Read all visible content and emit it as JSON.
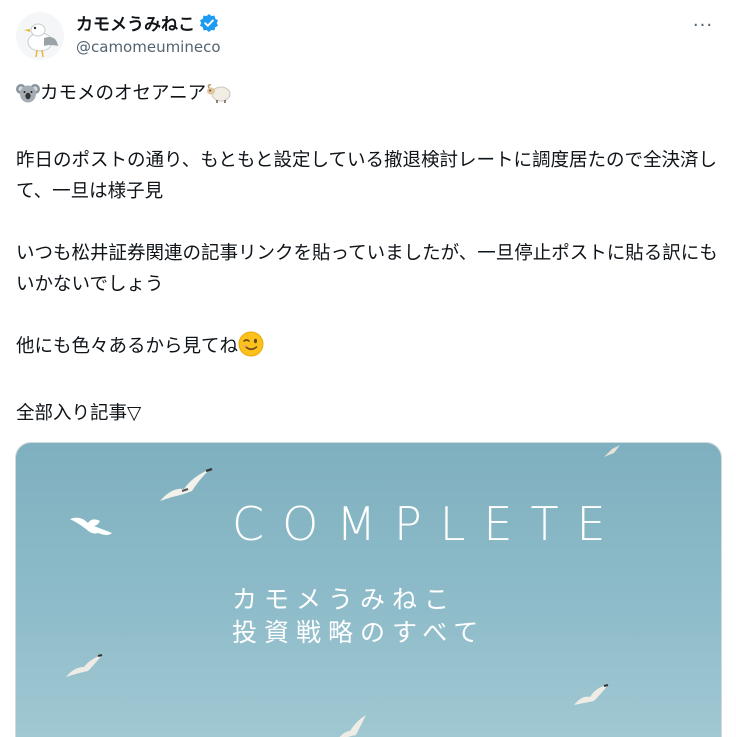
{
  "author": {
    "display_name": "カモメうみねこ",
    "handle": "@camomeumineco",
    "verified": true,
    "avatar_icon": "seagull-avatar-icon"
  },
  "menu": {
    "icon": "more-options-icon",
    "label": "···"
  },
  "tweet": {
    "line1": "カモメのオセアニア",
    "line2": "昨日のポストの通り、もともと設定している撤退検討レートに調度居たので全決済して、一旦は様子見",
    "line3": "いつも松井証券関連の記事リンクを貼っていましたが、一旦停止ポストに貼る訳にもいかないでしょう",
    "line4": "他にも色々あるから見てね",
    "line5": "全部入り記事▽"
  },
  "media": {
    "title": "COMPLETE",
    "subtitle_line1": "カモメうみねこ",
    "subtitle_line2": "投資戦略のすべて",
    "background_color": "#8cbac8"
  },
  "colors": {
    "verified": "#1d9bf0",
    "text": "#0f1419",
    "muted": "#536471"
  }
}
